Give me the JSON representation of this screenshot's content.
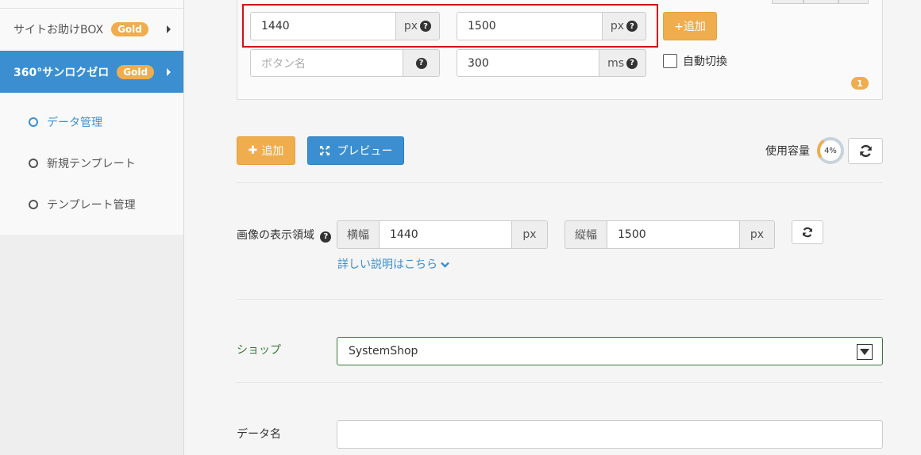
{
  "sidebar": {
    "items": [
      {
        "label": "サイトお助けBOX",
        "badge": "Gold"
      },
      {
        "label": "360°サンロクゼロ",
        "badge": "Gold"
      }
    ],
    "sub_items": [
      {
        "label": "データ管理"
      },
      {
        "label": "新規テンプレート"
      },
      {
        "label": "テンプレート管理"
      }
    ]
  },
  "panel": {
    "width_value": "1440",
    "width_unit": "px",
    "height_value": "1500",
    "height_unit": "px",
    "add_small_label": "+追加",
    "button_name_placeholder": "ボタン名",
    "duration_value": "300",
    "duration_unit": "ms",
    "auto_switch_label": "自動切換",
    "count_badge": "1"
  },
  "toolbar": {
    "add_label": "追加",
    "preview_label": "プレビュー",
    "usage_label": "使用容量",
    "usage_percent": "4%"
  },
  "display_area": {
    "label": "画像の表示領域",
    "width_prefix": "横幅",
    "width_value": "1440",
    "width_unit": "px",
    "height_prefix": "縦幅",
    "height_value": "1500",
    "height_unit": "px",
    "detail_link": "詳しい説明はこちら"
  },
  "shop": {
    "label": "ショップ",
    "selected": "SystemShop"
  },
  "data_name": {
    "label": "データ名",
    "value": ""
  },
  "colors": {
    "accent_blue": "#3b8fd1",
    "accent_orange": "#efad4e",
    "highlight_red": "#d0121b",
    "success_green": "#3c763d"
  }
}
